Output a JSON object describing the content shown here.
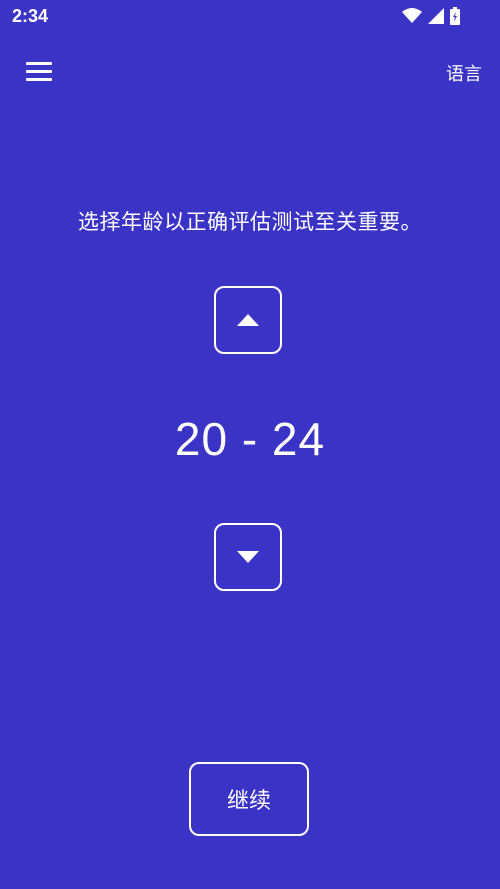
{
  "status_bar": {
    "time": "2:34",
    "icons": [
      "wifi-icon",
      "signal-icon",
      "battery-icon"
    ]
  },
  "app_bar": {
    "menu_icon": "menu-icon",
    "language_label": "语言"
  },
  "main": {
    "prompt": "选择年龄以正确评估测试至关重要。",
    "age_range": "20 - 24",
    "up_icon": "arrow-up-icon",
    "down_icon": "arrow-down-icon"
  },
  "footer": {
    "continue_label": "继续"
  },
  "colors": {
    "background": "#3b33c6",
    "foreground": "#ffffff"
  }
}
